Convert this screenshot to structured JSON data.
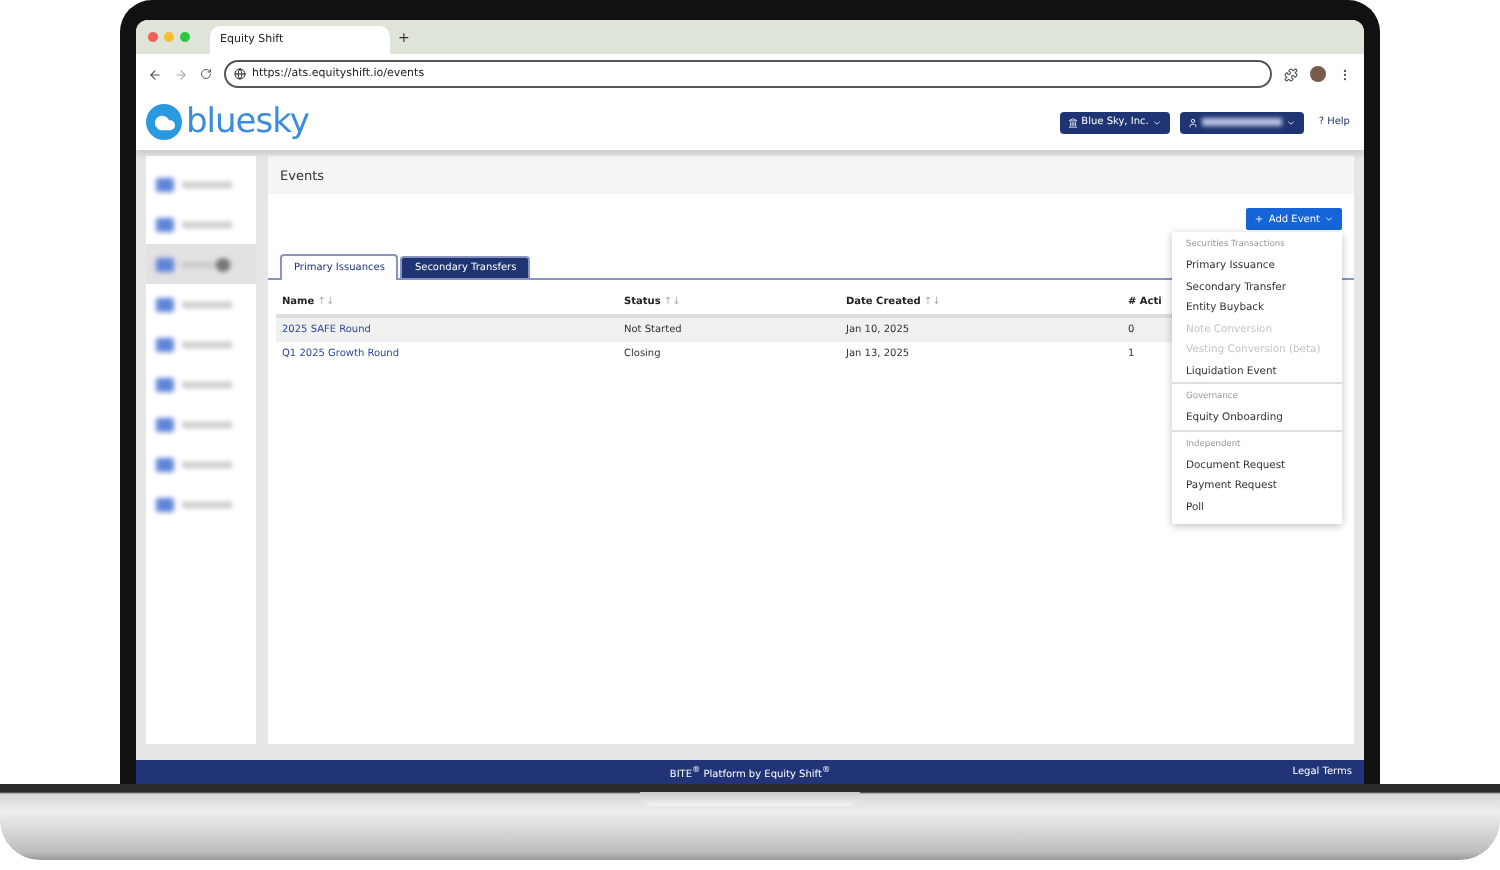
{
  "browser": {
    "tab_title": "Equity Shift",
    "new_tab": "+",
    "url": "https://ats.equityshift.io/events"
  },
  "header": {
    "logo": "bluesky",
    "company_button": "Blue Sky, Inc.",
    "help": "? Help"
  },
  "sidebar": {
    "items": [
      {
        "selected": false
      },
      {
        "selected": false
      },
      {
        "selected": true
      },
      {
        "selected": false
      },
      {
        "selected": false
      },
      {
        "selected": false
      },
      {
        "selected": false
      },
      {
        "selected": false
      },
      {
        "selected": false
      }
    ]
  },
  "page": {
    "title": "Events",
    "add_button": "Add Event"
  },
  "tabs": [
    {
      "label": "Primary Issuances",
      "selected": true
    },
    {
      "label": "Secondary Transfers",
      "selected": false
    }
  ],
  "table": {
    "columns": [
      {
        "label": "Name",
        "sort": "↑↓"
      },
      {
        "label": "Status",
        "sort": "↑↓"
      },
      {
        "label": "Date Created",
        "sort": "↑↓"
      },
      {
        "label": "# Acti"
      }
    ],
    "rows": [
      {
        "cells": [
          "2025 SAFE Round",
          "Not Started",
          "Jan 10, 2025",
          "0"
        ],
        "selected": true
      },
      {
        "cells": [
          "Q1 2025 Growth Round",
          "Closing",
          "Jan 13, 2025",
          "1"
        ],
        "selected": false
      }
    ]
  },
  "dropdown": {
    "groups": [
      {
        "heading": "Securities Transactions",
        "items": [
          {
            "label": "Primary Issuance",
            "disabled": false
          },
          {
            "label": "Secondary Transfer",
            "disabled": false
          },
          {
            "label": "Entity Buyback",
            "disabled": false
          },
          {
            "label": "Note Conversion",
            "disabled": true
          },
          {
            "label": "Vesting Conversion (beta)",
            "disabled": true
          },
          {
            "label": "Liquidation Event",
            "disabled": false
          }
        ]
      },
      {
        "heading": "Governance",
        "items": [
          {
            "label": "Equity Onboarding",
            "disabled": false
          }
        ]
      },
      {
        "heading": "Independent",
        "items": [
          {
            "label": "Document Request",
            "disabled": false
          },
          {
            "label": "Payment Request",
            "disabled": false
          },
          {
            "label": "Poll",
            "disabled": false
          }
        ]
      }
    ]
  },
  "footer": {
    "credit": "BITE$^{®}$  Platform by Equity Shift$^{®}$",
    "legal": "Legal Terms"
  }
}
